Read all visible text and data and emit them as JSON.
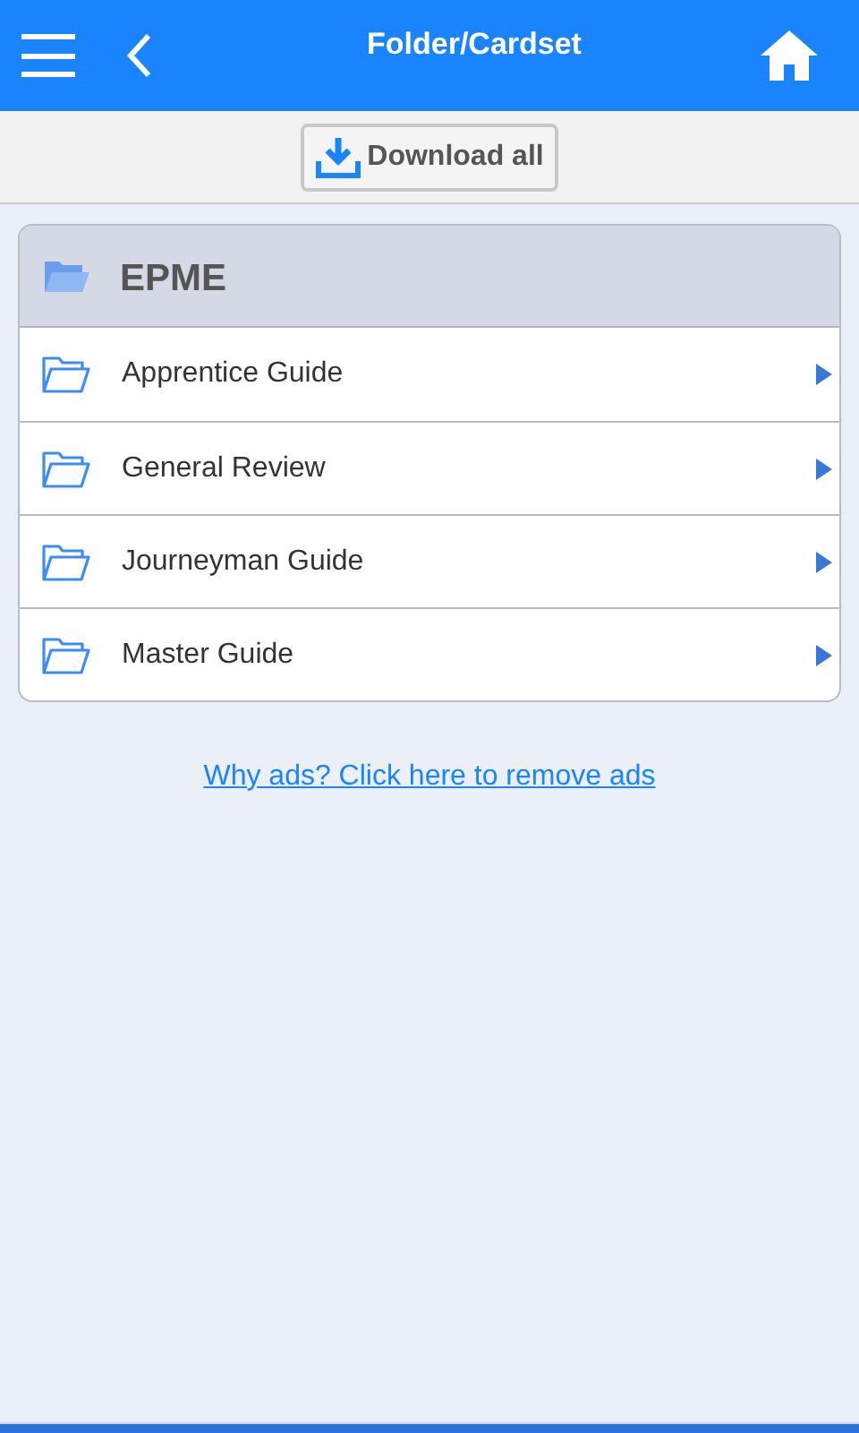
{
  "header": {
    "title": "Folder/Cardset"
  },
  "toolbar": {
    "download_button": "Download all"
  },
  "folder": {
    "title": "EPME",
    "items": [
      {
        "label": "Apprentice Guide"
      },
      {
        "label": "General Review"
      },
      {
        "label": "Journeyman Guide"
      },
      {
        "label": "Master Guide"
      }
    ]
  },
  "ads_link": "Why ads? Click here to remove ads"
}
